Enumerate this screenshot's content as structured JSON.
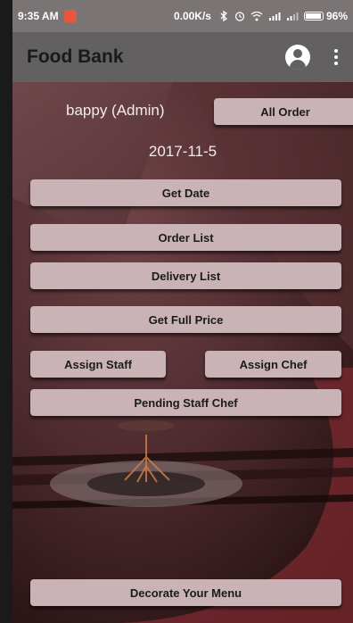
{
  "status_bar": {
    "time": "9:35 AM",
    "net_speed": "0.00K/s",
    "battery": "96%",
    "battery_level": 0.96
  },
  "app_bar": {
    "title": "Food Bank"
  },
  "user": {
    "label": "bappy (Admin)"
  },
  "date": "2017-11-5",
  "buttons": {
    "all_order": "All Order",
    "get_date": "Get Date",
    "order_list": "Order List",
    "delivery_list": "Delivery List",
    "get_full_price": "Get Full Price",
    "assign_staff": "Assign Staff",
    "assign_chef": "Assign Chef",
    "pending_staff_chef": "Pending Staff Chef",
    "decorate_menu": "Decorate Your Menu"
  },
  "colors": {
    "status_bar": "#7a7474",
    "app_bar": "#626060",
    "button": "#c9b3b6",
    "background": "#2a1416"
  }
}
